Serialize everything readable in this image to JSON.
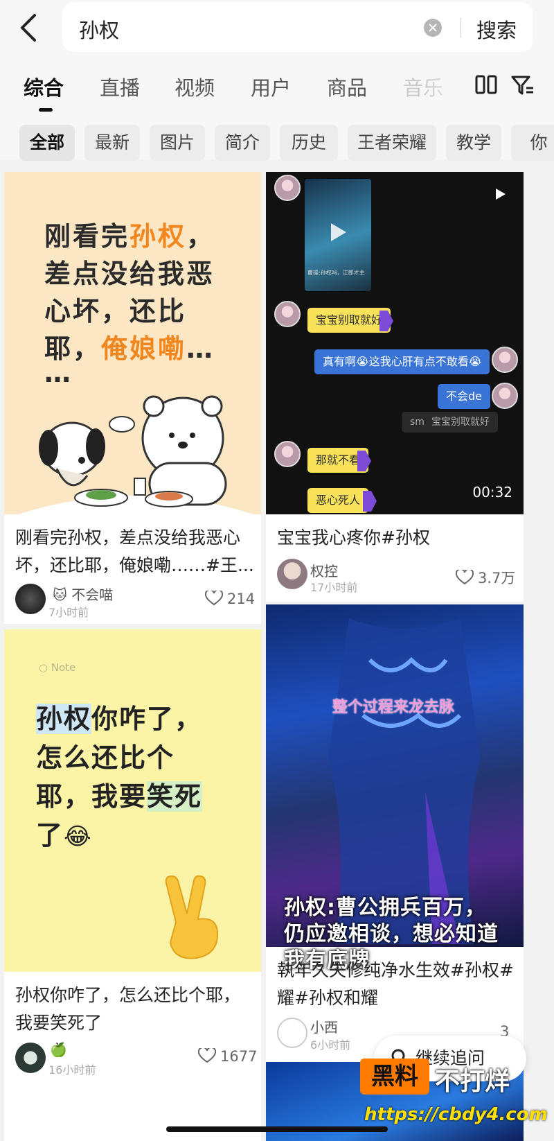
{
  "search": {
    "query": "孙权",
    "button_label": "搜索"
  },
  "tabs": [
    {
      "label": "综合",
      "active": true
    },
    {
      "label": "直播"
    },
    {
      "label": "视频"
    },
    {
      "label": "用户"
    },
    {
      "label": "商品"
    },
    {
      "label": "音乐"
    }
  ],
  "chips": [
    {
      "label": "全部",
      "active": true
    },
    {
      "label": "最新"
    },
    {
      "label": "图片"
    },
    {
      "label": "简介"
    },
    {
      "label": "历史"
    },
    {
      "label": "王者荣耀"
    },
    {
      "label": "教学"
    },
    {
      "label": "你"
    }
  ],
  "cards": [
    {
      "cover_lines": [
        "刚看完",
        "孙权",
        "，",
        "差点没给我恶",
        "心坏，还比",
        "耶，",
        "俺娘嘞",
        "…",
        "…"
      ],
      "title_lines": [
        "刚看完孙权，差点没给我恶心",
        "坏，还比耶，俺娘嘞……#王..."
      ],
      "author": "🐱 不会喵",
      "time": "7小时前",
      "likes": "214"
    },
    {
      "chat": {
        "video_caption": "曹操:孙权吗，江郎才主",
        "msg1": "宝宝别取就好",
        "msg2": "真有啊😭这我心肝有点不敢看😭",
        "msg3": "不会de",
        "msg4_name": "sm",
        "msg4": "宝宝别取就好",
        "msg5": "那就不看",
        "msg6": "恶心死人",
        "duration": "00:32"
      },
      "title_lines": [
        "宝宝我心疼你#孙权"
      ],
      "author": "权控",
      "time": "17小时前",
      "likes": "3.7万"
    },
    {
      "note_label": "Note",
      "cover_lines": [
        "孙权",
        "你咋了，",
        "怎么还比个",
        "耶，我要",
        "笑死",
        "了",
        "😂"
      ],
      "title_lines": [
        "孙权你咋了，怎么还比个耶，",
        "我要笑死了"
      ],
      "author": "🍏",
      "time": "16小时前",
      "likes": "1677"
    },
    {
      "pink_caption": "整个过程来龙去脉",
      "caption_lines": [
        "孙权:曹公拥兵百万，",
        "仍应邀相谈，想必知道",
        "我有底牌"
      ],
      "title_lines": [
        "執年久失修纯净水生效#孙权#",
        "耀#孙权和耀"
      ],
      "author": "小西",
      "time": "6小时前",
      "likes": "3"
    }
  ],
  "continue_button": "继续追问",
  "watermark": {
    "box": "黑料",
    "text": "不打烊",
    "url": "https://cbdy4.com"
  }
}
